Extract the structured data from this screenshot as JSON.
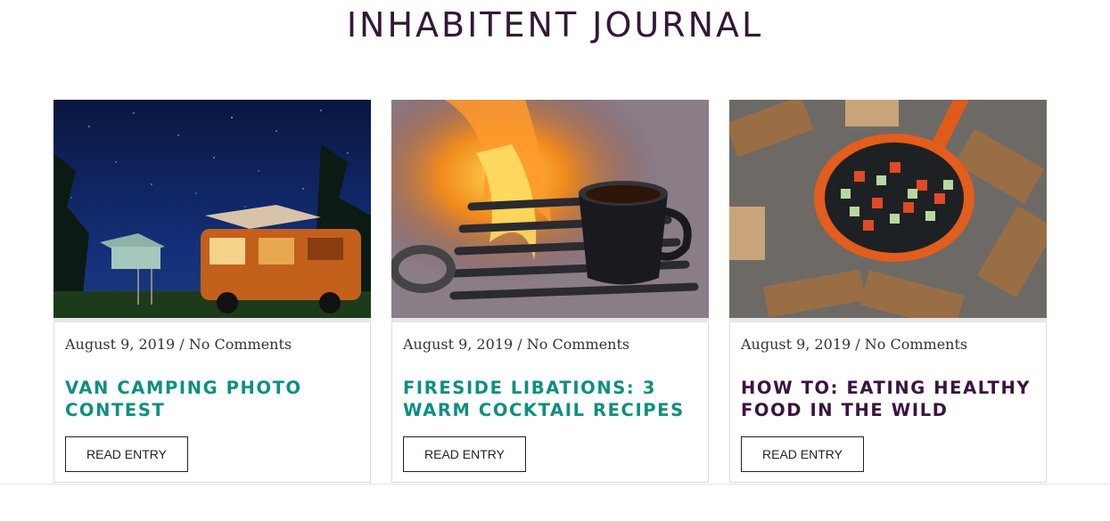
{
  "journal": {
    "title": "INHABITENT JOURNAL"
  },
  "posts": [
    {
      "meta": "August 9, 2019 / No Comments",
      "title": "VAN CAMPING PHOTO CONTEST",
      "title_color": "#0d8f80",
      "button": "READ ENTRY",
      "image_icon": "van-camping-photo"
    },
    {
      "meta": "August 9, 2019 / No Comments",
      "title": "FIRESIDE LIBATIONS: 3 WARM COCKTAIL RECIPES",
      "title_color": "#0d8f80",
      "button": "READ ENTRY",
      "image_icon": "campfire-coffee-photo"
    },
    {
      "meta": "August 9, 2019 / No Comments",
      "title": "HOW TO: EATING HEALTHY FOOD IN THE WILD",
      "title_color": "#3b1340",
      "button": "READ ENTRY",
      "image_icon": "campfire-pan-photo"
    }
  ]
}
